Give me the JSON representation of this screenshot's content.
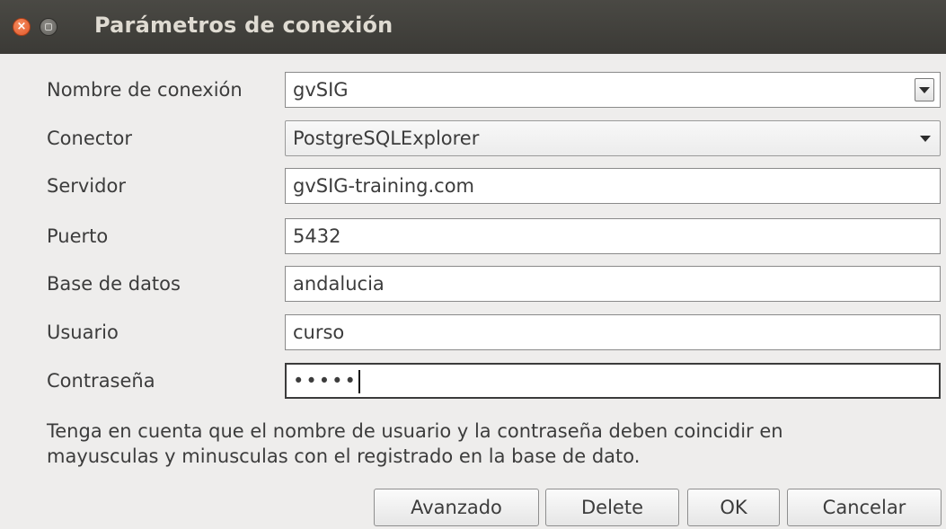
{
  "window": {
    "title": "Parámetros de conexión",
    "close_glyph": "×"
  },
  "form": {
    "rows": [
      {
        "label": "Nombre de conexión",
        "value": "gvSIG",
        "control": "editable-combo"
      },
      {
        "label": "Conector",
        "value": "PostgreSQLExplorer",
        "control": "combo"
      },
      {
        "label": "Servidor",
        "value": "gvSIG-training.com",
        "control": "text"
      },
      {
        "label": "Puerto",
        "value": "5432",
        "control": "text"
      },
      {
        "label": "Base de datos",
        "value": "andalucia",
        "control": "text"
      },
      {
        "label": "Usuario",
        "value": "curso",
        "control": "text"
      },
      {
        "label": "Contraseña",
        "value": "•••••",
        "control": "password"
      }
    ]
  },
  "note": {
    "line1": "Tenga en cuenta que el nombre de usuario y la contraseña deben coincidir en",
    "line2": "mayusculas y minusculas con el registrado en la base de dato."
  },
  "buttons": {
    "advanced": "Avanzado",
    "delete": "Delete",
    "ok": "OK",
    "cancel": "Cancelar"
  },
  "icons": {
    "close": "close-icon",
    "minimize": "minimize-icon",
    "dropdown": "chevron-down-icon"
  }
}
